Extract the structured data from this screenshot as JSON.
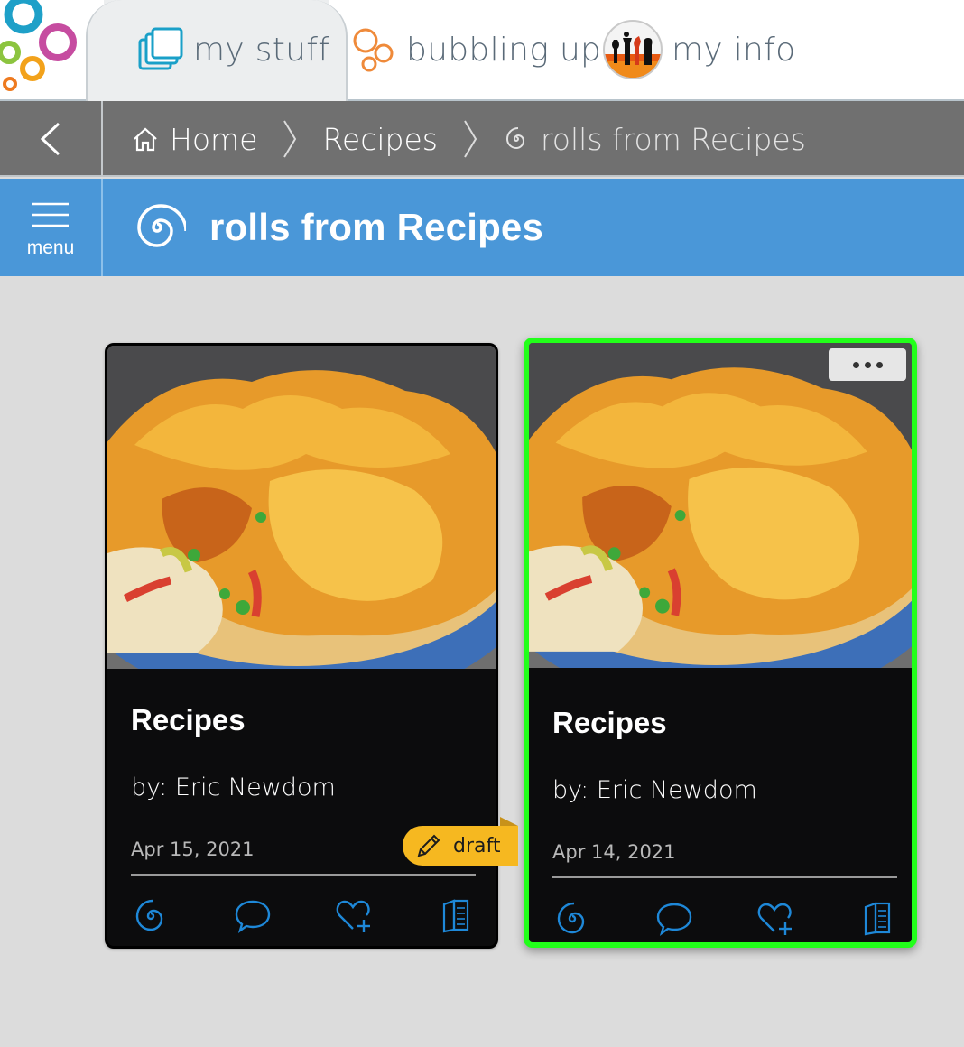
{
  "tabs": {
    "my_stuff": "my stuff",
    "bubbling_up": "bubbling up",
    "my_info": "my info"
  },
  "breadcrumb": {
    "home": "Home",
    "recipes": "Recipes",
    "current": "rolls from Recipes"
  },
  "titlebar": {
    "menu_label": "menu",
    "title": "rolls from Recipes"
  },
  "cards": [
    {
      "title": "Recipes",
      "author": "by: Eric Newdom",
      "date": "Apr 15, 2021",
      "draft_label": "draft"
    },
    {
      "title": "Recipes",
      "author": "by: Eric Newdom",
      "date": "Apr 14, 2021"
    }
  ],
  "colors": {
    "accent_blue": "#4a97d8",
    "selection_green": "#22ff1a",
    "draft_yellow": "#f6b820",
    "action_icon": "#1e88d8"
  },
  "icons": [
    "logo-circles-icon",
    "folders-icon",
    "bubbles-icon",
    "chess-avatar-icon",
    "chevron-left-icon",
    "home-icon",
    "chevron-right-icon",
    "spiral-icon",
    "hamburger-icon",
    "comment-icon",
    "heart-plus-icon",
    "book-icon",
    "pencil-icon",
    "more-dots-icon"
  ]
}
